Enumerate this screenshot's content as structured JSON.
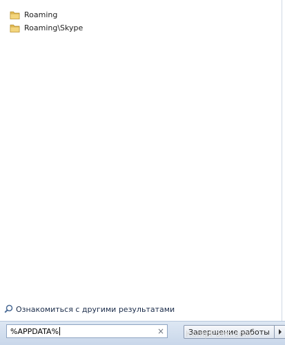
{
  "results": {
    "items": [
      {
        "label": "Roaming",
        "icon": "folder-icon"
      },
      {
        "label": "Roaming\\Skype",
        "icon": "folder-icon"
      }
    ]
  },
  "more_results": {
    "label": "Ознакомиться с другими результатами",
    "icon": "search-icon"
  },
  "search": {
    "value": "%APPDATA%",
    "clear_symbol": "×"
  },
  "shutdown": {
    "label": "Завершение работы",
    "arrow_icon": "arrow-right-icon"
  },
  "watermark": {
    "text": "KompForm.com"
  },
  "colors": {
    "folder": "#e8c25a",
    "bottom_bar": "#d2deee",
    "link": "#1b2c4a"
  }
}
